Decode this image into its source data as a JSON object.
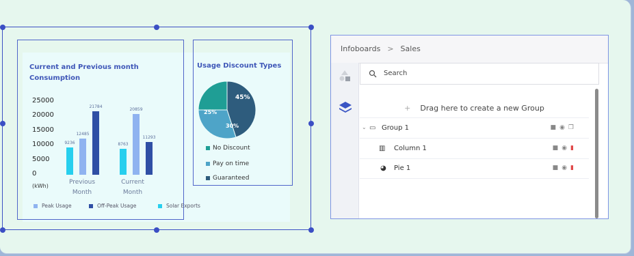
{
  "chart_data": [
    {
      "type": "bar",
      "title": "Current and Previous month Consumption",
      "categories": [
        "Previous Month",
        "Current Month"
      ],
      "series": [
        {
          "name": "Peak Usage",
          "values": [
            12485,
            20859
          ],
          "color": "#8fb3f0"
        },
        {
          "name": "Off-Peak Usage",
          "values": [
            21784,
            11293
          ],
          "color": "#2f4fa5"
        },
        {
          "name": "Solar Exports",
          "values": [
            9236,
            8763
          ],
          "color": "#27cfee"
        }
      ],
      "bar_labels": [
        "9236",
        "12485",
        "21784",
        "8763",
        "20859",
        "11293"
      ],
      "yticks": [
        "25000",
        "20000",
        "15000",
        "10000",
        "5000",
        "0"
      ],
      "ylabel": "(kWh)",
      "ylim": [
        0,
        25000
      ]
    },
    {
      "type": "pie",
      "title": "Usage Discount Types",
      "slices": [
        {
          "name": "No Discount",
          "value": 25,
          "label": "25%",
          "color": "#1f9e95"
        },
        {
          "name": "Pay on time",
          "value": 30,
          "label": "30%",
          "color": "#4ea4c8"
        },
        {
          "name": "Guaranteed",
          "value": 45,
          "label": "45%",
          "color": "#2e5c7d"
        }
      ]
    }
  ],
  "chart": {
    "title": "Current and Previous month Consumption",
    "ylabel": "(kWh)",
    "xlabel_prev": "Previous\nMonth",
    "xlabel_cur": "Current\nMonth",
    "legend": [
      "Peak Usage",
      "Off-Peak Usage",
      "Solar Exports"
    ],
    "ticks": [
      "25000",
      "20000",
      "15000",
      "10000",
      "5000",
      "0"
    ]
  },
  "pie": {
    "title": "Usage Discount Types",
    "legend": [
      "No Discount",
      "Pay on time",
      "Guaranteed"
    ],
    "labels": [
      "45%",
      "25%",
      "30%"
    ]
  },
  "panel": {
    "breadcrumb_root": "Infoboards",
    "breadcrumb_sep": ">",
    "breadcrumb_current": "Sales",
    "search_placeholder": "Search",
    "dropzone": "Drag here to create a new Group",
    "dropzone_plus": "+",
    "tree": [
      {
        "label": "Group 1",
        "icon": "folder-icon"
      },
      {
        "label": "Column 1",
        "icon": "column-chart-icon"
      },
      {
        "label": "Pie 1",
        "icon": "pie-chart-icon"
      }
    ]
  }
}
